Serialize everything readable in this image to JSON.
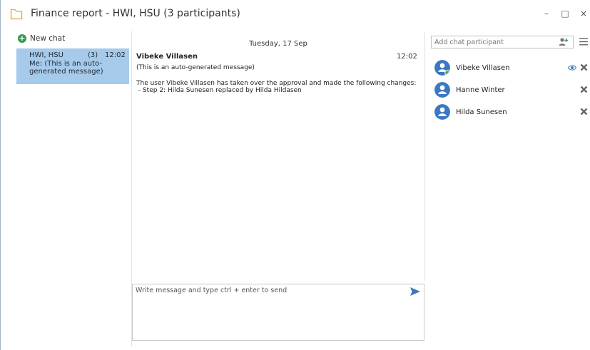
{
  "window": {
    "title": "Finance report - HWI, HSU (3 participants)",
    "minimize_glyph": "–",
    "maximize_glyph": "□",
    "close_glyph": "×"
  },
  "sidebar": {
    "new_chat_label": "New chat",
    "chats": [
      {
        "name": "HWI, HSU",
        "count": "(3)",
        "time": "12:02",
        "preview": "Me: (This is an auto-generated message)",
        "selected": true
      }
    ]
  },
  "conversation": {
    "date": "Tuesday, 17 Sep",
    "messages": [
      {
        "sender": "Vibeke Villasen",
        "time": "12:02",
        "lines": [
          "(This is an auto-generated message)",
          "The user Vibeke Villasen has taken over the approval and made the following changes:",
          " - Step 2: Hilda Sunesen replaced by Hilda Hildasen"
        ]
      }
    ],
    "compose_placeholder": "Write message and type ctrl + enter to send"
  },
  "participants_panel": {
    "add_placeholder": "Add chat participant",
    "participants": [
      {
        "name": "Vibeke Villasen",
        "online": true,
        "watching": true
      },
      {
        "name": "Hanne Winter",
        "online": false,
        "watching": false
      },
      {
        "name": "Hilda Sunesen",
        "online": false,
        "watching": false
      }
    ]
  },
  "colors": {
    "accent": "#3a78c4",
    "selected_chat": "#a6cae9",
    "online": "#4caf50",
    "new_chat_icon": "#2e9c4b",
    "title_icon": "#e8a33d"
  },
  "icons": {
    "title": "chat-folder-icon",
    "new_chat": "plus-circle-icon",
    "send": "send-arrow-icon",
    "add_participant": "add-person-icon",
    "menu": "hamburger-menu-icon",
    "watching": "eye-icon",
    "remove": "remove-x-icon"
  }
}
